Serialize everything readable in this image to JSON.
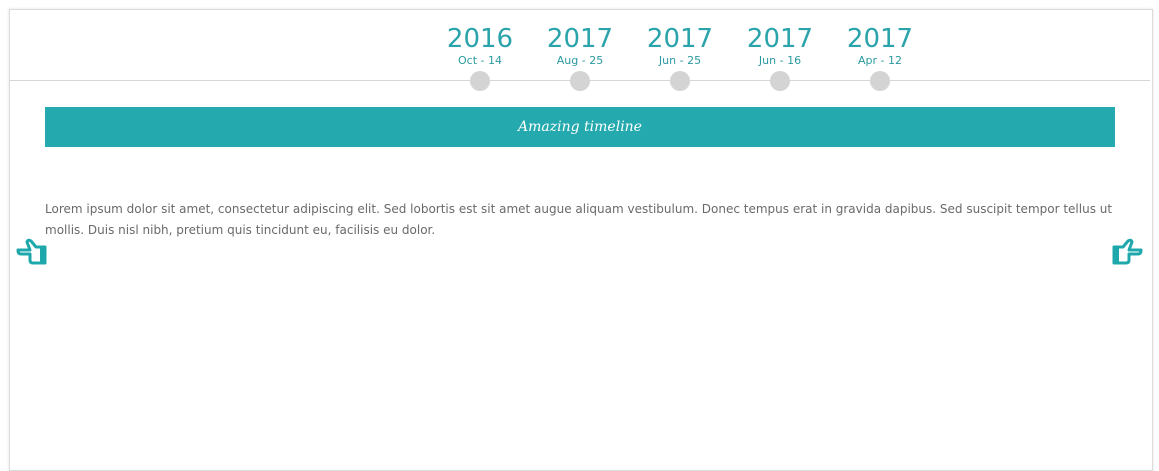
{
  "timeline": {
    "dates": [
      {
        "year": "2016",
        "day": "Oct - 14"
      },
      {
        "year": "2017",
        "day": "Aug - 25"
      },
      {
        "year": "2017",
        "day": "Jun - 25"
      },
      {
        "year": "2017",
        "day": "Jun - 16"
      },
      {
        "year": "2017",
        "day": "Apr - 12"
      }
    ],
    "banner_title": "Amazing timeline",
    "body_text": "Lorem ipsum dolor sit amet, consectetur adipiscing elit. Sed lobortis est sit amet augue aliquam vestibulum. Donec tempus erat in gravida dapibus. Sed suscipit tempor tellus ut mollis. Duis nisl nibh, pretium quis tincidunt eu, facilisis eu dolor."
  },
  "icons": {
    "prev": "pointing-hand-left-icon",
    "next": "pointing-hand-right-icon"
  },
  "colors": {
    "accent": "#23a9ae",
    "dot": "#d4d4d4",
    "text": "#6a6a6a"
  }
}
